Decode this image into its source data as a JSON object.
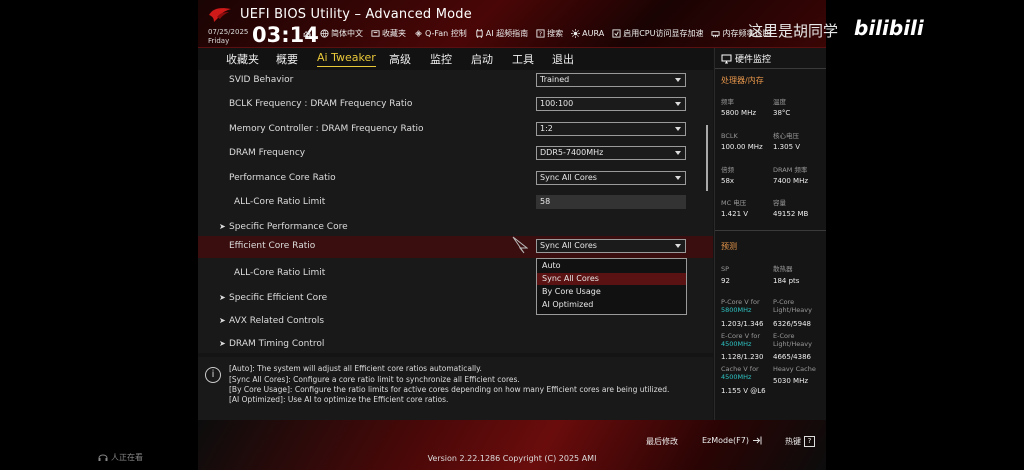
{
  "header": {
    "title": "UEFI BIOS Utility – Advanced Mode",
    "date": "07/25/2025",
    "day": "Friday",
    "time": "03:14",
    "tools": [
      {
        "label": "简体中文",
        "icon": "globe-icon"
      },
      {
        "label": "收藏夹",
        "icon": "bookmark-icon"
      },
      {
        "label": "Q-Fan 控制",
        "icon": "fan-icon"
      },
      {
        "label": "AI 超频指南",
        "icon": "ai-icon"
      },
      {
        "label": "搜索",
        "icon": "search-icon"
      },
      {
        "label": "AURA",
        "icon": "aura-icon"
      },
      {
        "label": "启用CPU访问显存加速",
        "icon": "chip-icon"
      },
      {
        "label": "内存频率诊断",
        "icon": "memory-icon"
      }
    ]
  },
  "watermark": {
    "text": "这里是胡同学",
    "logo": "bilibili"
  },
  "menu": {
    "items": [
      "收藏夹",
      "概要",
      "Ai Tweaker",
      "高级",
      "监控",
      "启动",
      "工具",
      "退出"
    ],
    "active": "Ai Tweaker"
  },
  "settings": [
    {
      "label": "SVID Behavior",
      "value": "Trained",
      "kind": "select"
    },
    {
      "label": "BCLK Frequency : DRAM Frequency Ratio",
      "value": "100:100",
      "kind": "select"
    },
    {
      "label": "Memory Controller : DRAM Frequency Ratio",
      "value": "1:2",
      "kind": "select"
    },
    {
      "label": "DRAM Frequency",
      "value": "DDR5-7400MHz",
      "kind": "select"
    },
    {
      "label": "Performance Core Ratio",
      "value": "Sync All Cores",
      "kind": "select"
    },
    {
      "label": "ALL-Core Ratio Limit",
      "value": "58",
      "kind": "text"
    },
    {
      "label": "Specific Performance Core",
      "kind": "submenu"
    },
    {
      "label": "Efficient Core Ratio",
      "value": "Sync All Cores",
      "kind": "select",
      "selected": true
    },
    {
      "label": "ALL-Core Ratio Limit",
      "kind": "label"
    },
    {
      "label": "Specific Efficient Core",
      "kind": "submenu"
    },
    {
      "label": "AVX Related Controls",
      "kind": "submenu"
    },
    {
      "label": "DRAM Timing Control",
      "kind": "submenu"
    }
  ],
  "dropdown": {
    "options": [
      "Auto",
      "Sync All Cores",
      "By Core Usage",
      "AI Optimized"
    ],
    "selected": "Sync All Cores"
  },
  "help": {
    "lines": [
      "[Auto]: The system will adjust all Efficient core ratios automatically.",
      "[Sync All Cores]: Configure a core ratio limit to synchronize all Efficient cores.",
      "[By Core Usage]: Configure the ratio limits for active cores depending on how many Efficient cores are being utilized.",
      "[AI Optimized]: Use AI to optimize the Efficient core ratios."
    ]
  },
  "hardware_monitor": {
    "title": "硬件监控",
    "section_cpu": "处理器/内存",
    "stats": [
      {
        "label": "频率",
        "value": "5800 MHz"
      },
      {
        "label": "温度",
        "value": "38°C"
      },
      {
        "label": "BCLK",
        "value": "100.00 MHz"
      },
      {
        "label": "核心电压",
        "value": "1.305 V"
      },
      {
        "label": "倍频",
        "value": "58x"
      },
      {
        "label": "DRAM 频率",
        "value": "7400 MHz"
      },
      {
        "label": "MC 电压",
        "value": "1.421 V"
      },
      {
        "label": "容量",
        "value": "49152 MB"
      }
    ],
    "section_predict": "预测",
    "predict": [
      {
        "label": "SP",
        "value": "92"
      },
      {
        "label": "散热器",
        "value": "184 pts"
      },
      {
        "label": "P-Core V for",
        "label2": "5800MHz",
        "value": "1.203/1.346"
      },
      {
        "label": "P-Core",
        "label2": "Light/Heavy",
        "value": "6326/5948"
      },
      {
        "label": "E-Core V for",
        "label2": "4500MHz",
        "value": "1.128/1.230"
      },
      {
        "label": "E-Core",
        "label2": "Light/Heavy",
        "value": "4665/4386"
      },
      {
        "label": "Cache V for",
        "label2": "4500MHz",
        "value": "1.155 V @L6"
      },
      {
        "label": "Heavy Cache",
        "label2": "",
        "value": "5030 MHz"
      }
    ]
  },
  "footer": {
    "last_modified": "最后修改",
    "ezmode": "EzMode(F7)",
    "hotkeys": "热键",
    "hotkeys_key": "?",
    "version": "Version 2.22.1286 Copyright (C) 2025 AMI"
  },
  "status_left": "人正在看"
}
